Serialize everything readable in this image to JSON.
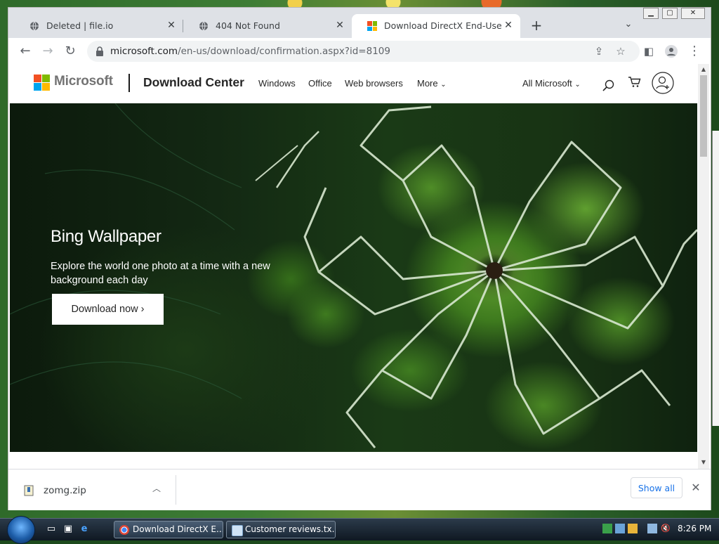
{
  "browser": {
    "tabs": [
      {
        "title": "Deleted | file.io",
        "favicon": "globe-icon",
        "state": "inactive"
      },
      {
        "title": "404 Not Found",
        "favicon": "globe-icon",
        "state": "inactive"
      },
      {
        "title": "Download DirectX End-User Runt",
        "favicon": "microsoft-logo",
        "state": "active"
      }
    ],
    "address_bar": {
      "host": "microsoft.com",
      "path": "/en-us/download/confirmation.aspx?id=8109"
    }
  },
  "page": {
    "brand": "Microsoft",
    "section_title": "Download Center",
    "nav": [
      "Windows",
      "Office",
      "Web browsers",
      "More"
    ],
    "all_microsoft": "All Microsoft",
    "hero": {
      "title": "Bing Wallpaper",
      "description": "Explore the world one photo at a time with a new background each day",
      "button": "Download now"
    }
  },
  "downloads": {
    "file_name": "zomg.zip",
    "show_all": "Show all"
  },
  "taskbar": {
    "items": [
      {
        "label": "Download DirectX E...",
        "state": "active"
      },
      {
        "label": "Customer reviews.tx...",
        "state": "inactive"
      }
    ],
    "clock": "8:26 PM"
  },
  "colors": {
    "ms_red": "#f25022",
    "ms_green": "#7fba00",
    "ms_blue": "#00a4ef",
    "ms_yellow": "#ffb900",
    "link_blue": "#1a73e8"
  }
}
